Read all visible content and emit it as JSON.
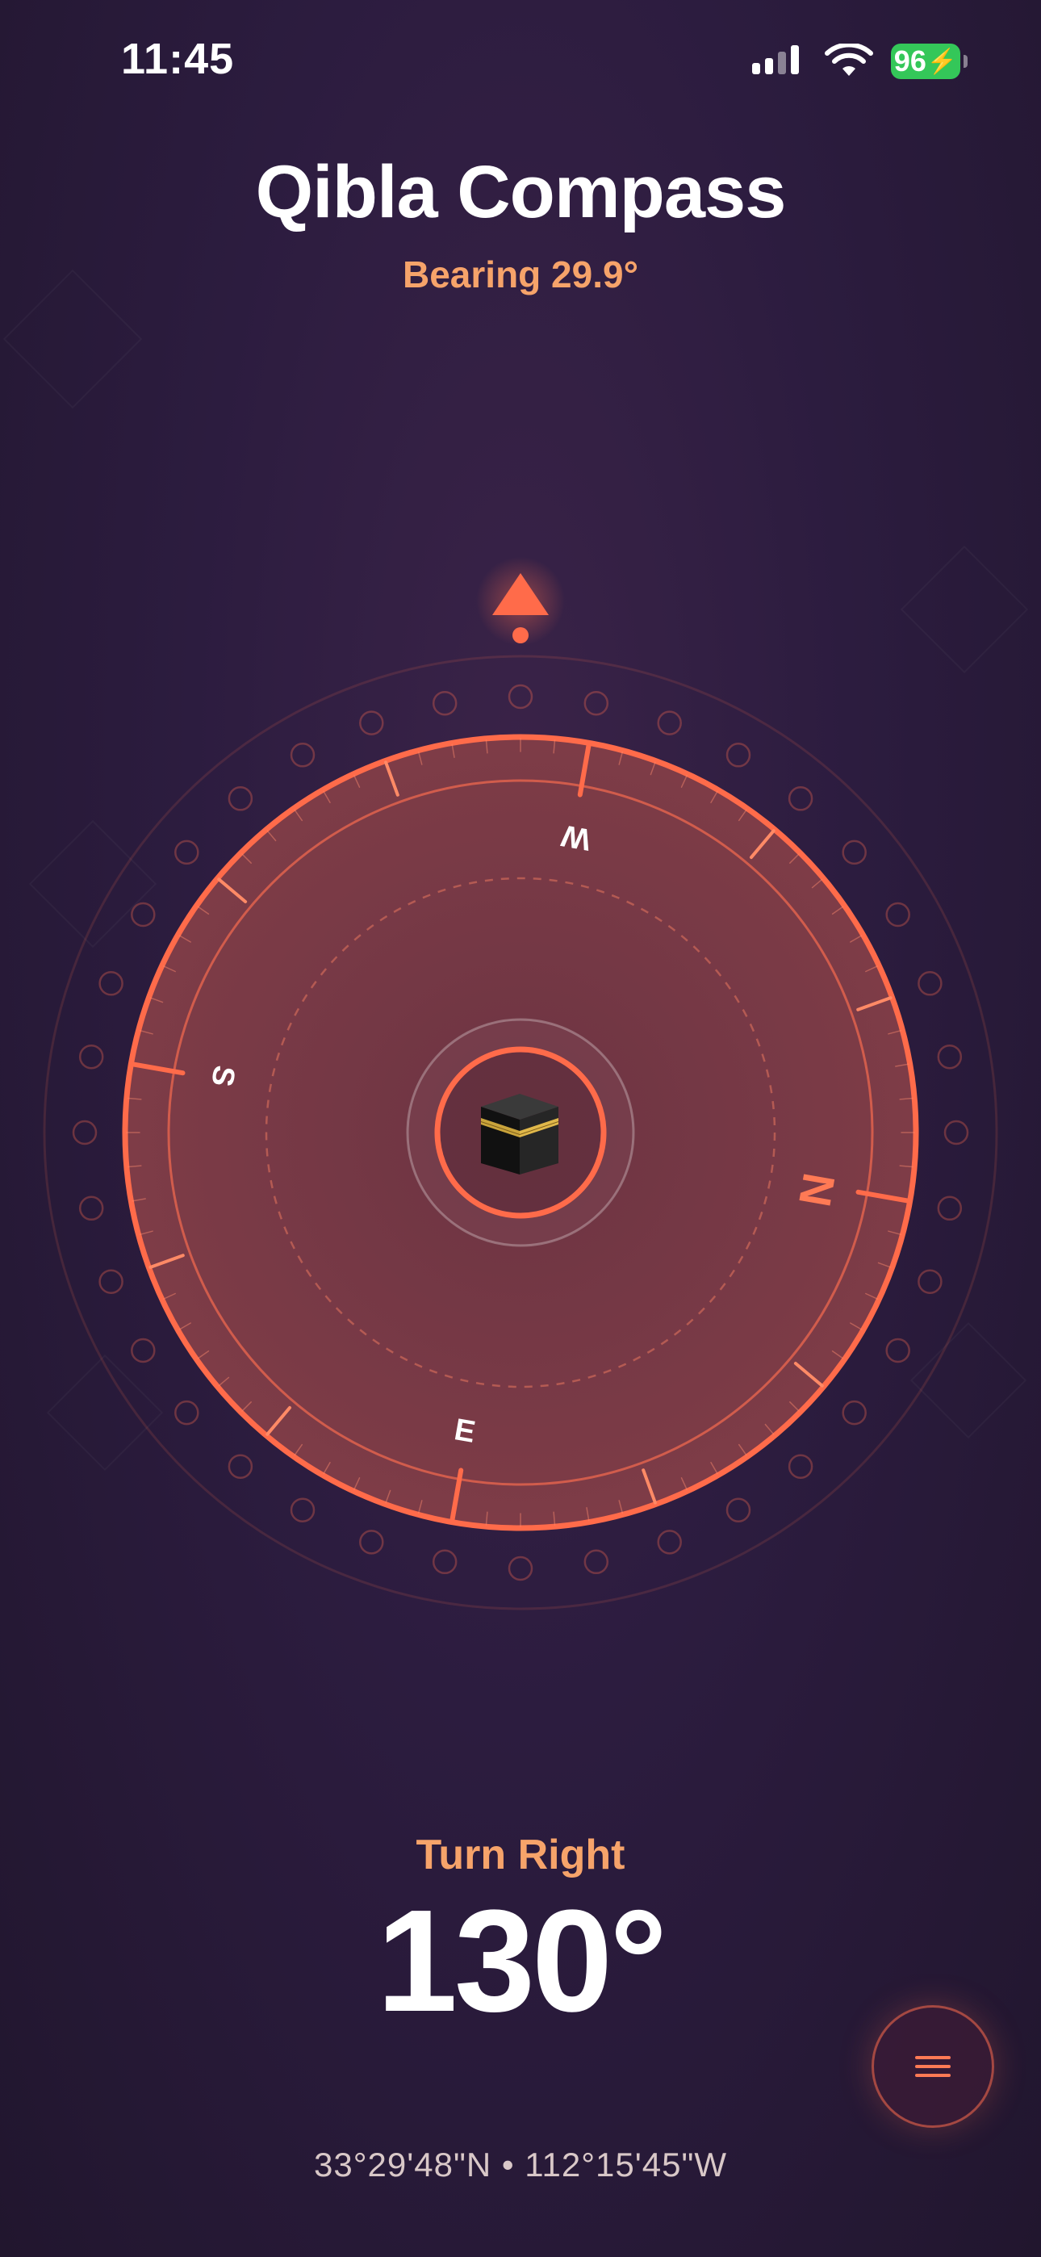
{
  "status_bar": {
    "time": "11:45",
    "battery": "96",
    "icons": [
      "cellular-signal-icon",
      "wifi-icon",
      "battery-charging-icon"
    ]
  },
  "header": {
    "title": "Qibla Compass",
    "subtitle": "Bearing 29.9°"
  },
  "compass": {
    "cardinals": {
      "n": "N",
      "e": "E",
      "s": "S",
      "w": "W"
    },
    "center_icon": "kaaba-icon",
    "top_indicator_icon": "triangle-up-icon"
  },
  "direction": {
    "label": "Turn Right",
    "value": "130°"
  },
  "footer": {
    "coordinates": "33°29'48\"N • 112°15'45\"W"
  },
  "menu_icon": "menu-icon",
  "colors": {
    "accent": "#ff6b4a",
    "accent_soft": "#f6a36a",
    "background": "#2c1c3f",
    "dial_fill": "#7a3a45",
    "battery": "#34c759"
  }
}
